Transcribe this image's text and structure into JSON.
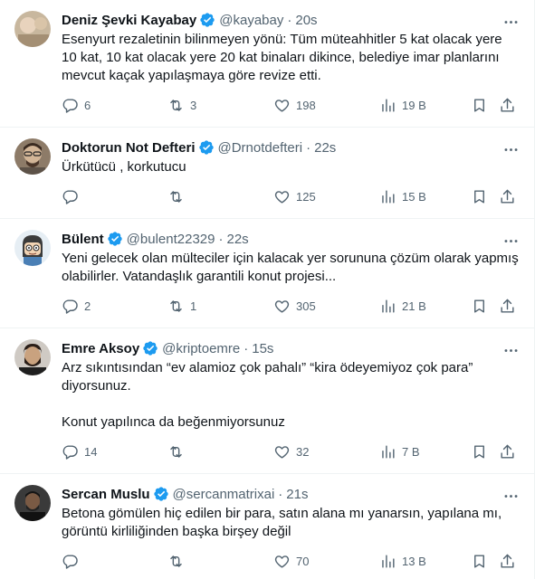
{
  "tweets": [
    {
      "name": "Deniz Şevki Kayabay",
      "handle": "@kayabay",
      "separator": "·",
      "time": "20s",
      "text": "Esenyurt rezaletinin bilinmeyen yönü: Tüm müteahhitler 5 kat olacak yere 10 kat, 10 kat olacak yere 20 kat binaları dikince, belediye imar planlarını mevcut kaçak yapılaşmaya göre revize etti.",
      "replies": "6",
      "retweets": "3",
      "likes": "198",
      "views": "19 B",
      "avatar_color": "#b9a58c"
    },
    {
      "name": "Doktorun Not Defteri",
      "handle": "@Drnotdefteri",
      "separator": "·",
      "time": "22s",
      "text": "Ürkütücü , korkutucu",
      "replies": "",
      "retweets": "",
      "likes": "125",
      "views": "15 B",
      "avatar_color": "#6a5a4a"
    },
    {
      "name": "Bülent",
      "handle": "@bulent22329",
      "separator": "·",
      "time": "22s",
      "text": "Yeni gelecek olan mülteciler için kalacak yer sorununa çözüm olarak yapmış olabilirler. Vatandaşlık garantili konut projesi...",
      "replies": "2",
      "retweets": "1",
      "likes": "305",
      "views": "21 B",
      "avatar_color": "#dfe9f0"
    },
    {
      "name": "Emre Aksoy",
      "handle": "@kriptoemre",
      "separator": "·",
      "time": "15s",
      "text": "Arz sıkıntısından “ev alamioz çok pahalı” “kira ödeyemiyoz çok para” diyorsunuz.\n\nKonut yapılınca da beğenmiyorsunuz",
      "replies": "14",
      "retweets": "",
      "likes": "32",
      "views": "7 B",
      "avatar_color": "#3a2e28"
    },
    {
      "name": "Sercan Muslu",
      "handle": "@sercanmatrixai",
      "separator": "·",
      "time": "21s",
      "text": "Betona gömülen hiç edilen bir para, satın alana mı yanarsın, yapılana mı, görüntü kirliliğinden başka birşey değil",
      "replies": "",
      "retweets": "",
      "likes": "70",
      "views": "13 B",
      "avatar_color": "#2b2b2b"
    }
  ],
  "colors": {
    "verified": "#1d9bf0",
    "muted": "#536471",
    "text": "#0f1419",
    "divider": "#eff3f4"
  },
  "icons": [
    "verified-badge-icon",
    "more-icon",
    "reply-icon",
    "retweet-icon",
    "like-icon",
    "views-icon",
    "bookmark-icon",
    "share-icon"
  ]
}
